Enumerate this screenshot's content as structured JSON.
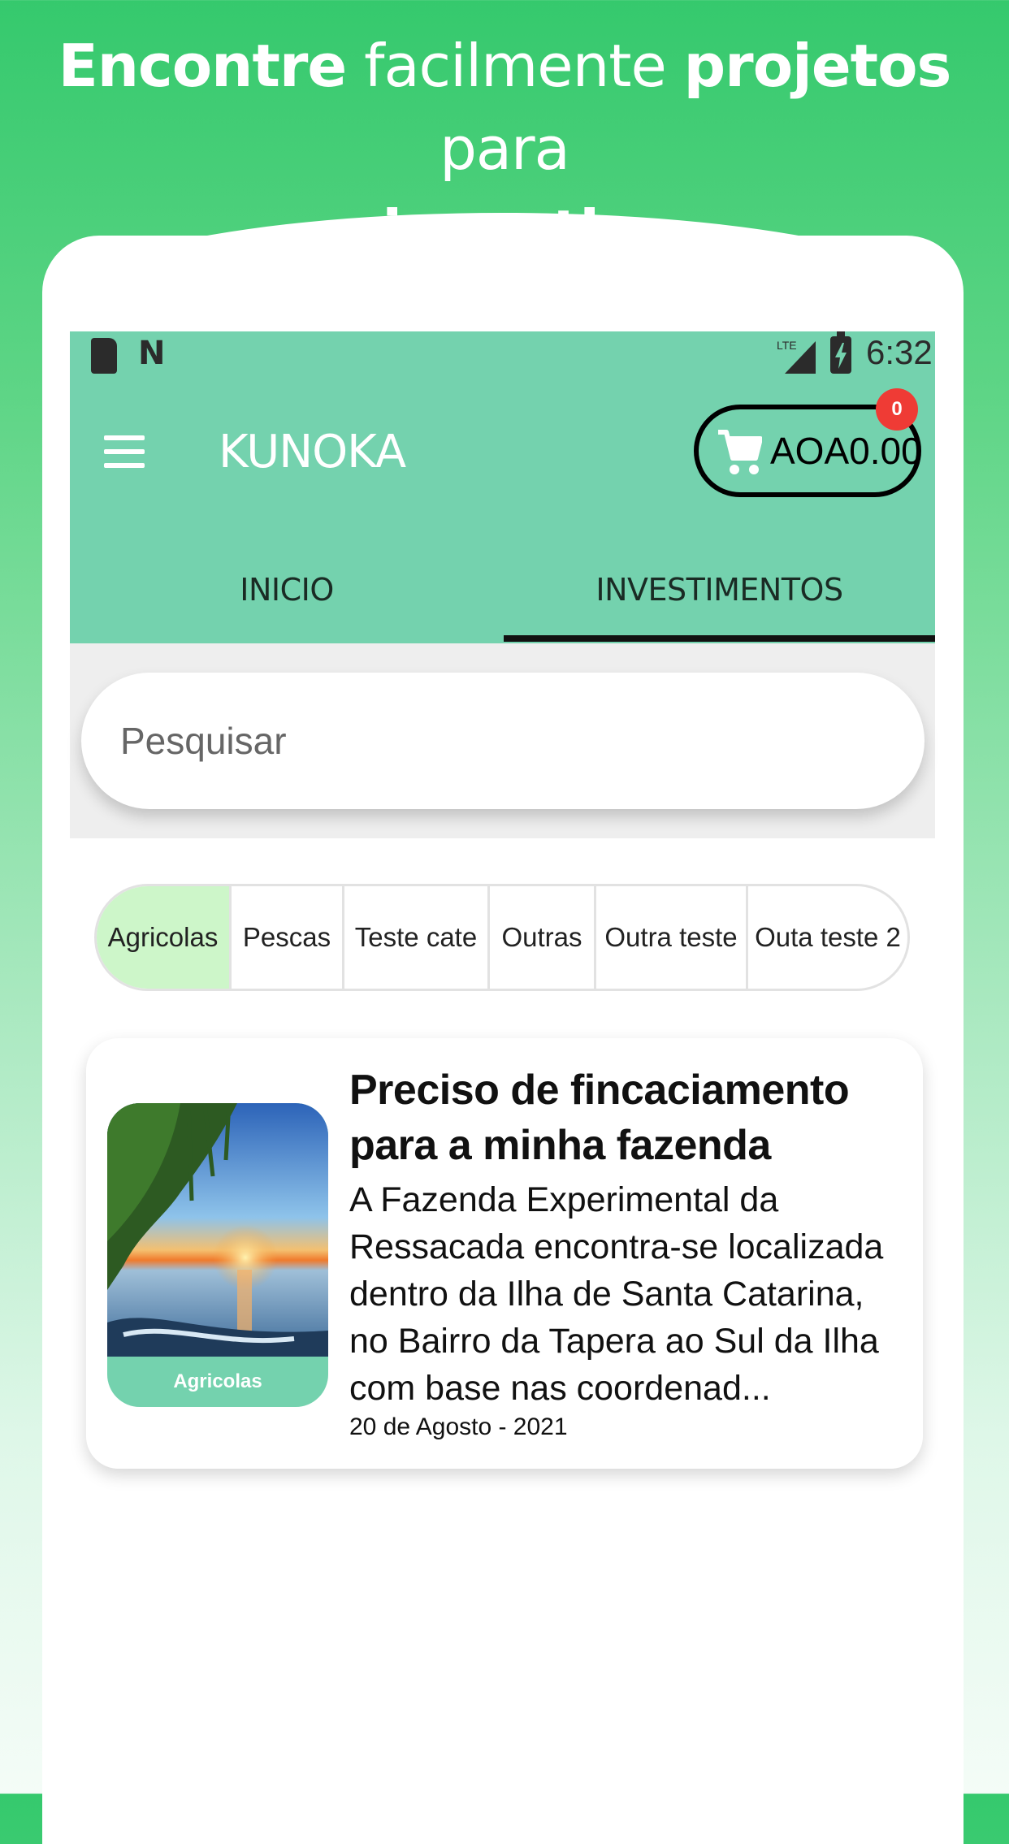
{
  "headline": {
    "part1": "Encontre",
    "part2": " facilmente ",
    "part3": "projetos",
    "part4": " para",
    "part5": "investir"
  },
  "statusbar": {
    "network": "LTE",
    "time": "6:32"
  },
  "appbar": {
    "title": "KUNOKA",
    "cart_total": "AOA0.00",
    "cart_badge": "0"
  },
  "tabs": [
    {
      "label": "INICIO",
      "active": false
    },
    {
      "label": "INVESTIMENTOS",
      "active": true
    }
  ],
  "search": {
    "placeholder": "Pesquisar"
  },
  "categories": [
    {
      "label": "Agricolas",
      "active": true
    },
    {
      "label": "Pescas",
      "active": false
    },
    {
      "label": "Teste cate",
      "active": false
    },
    {
      "label": "Outras",
      "active": false
    },
    {
      "label": "Outra teste",
      "active": false
    },
    {
      "label": "Outa teste 2",
      "active": false
    }
  ],
  "projects": [
    {
      "title": "Preciso de fincaciamento para a minha fazenda",
      "description": "A Fazenda Experimental da Ressacada encontra-se localizada dentro da Ilha de Santa Catarina, no Bairro da Tapera ao Sul da Ilha com base nas coordenad...",
      "date": "20  de Agosto - 2021",
      "category": "Agricolas"
    }
  ],
  "colors": {
    "appbar": "#74d2ae",
    "background_top": "#35c96d",
    "badge": "#ef3b35",
    "chip_active": "#cdf6c9"
  }
}
